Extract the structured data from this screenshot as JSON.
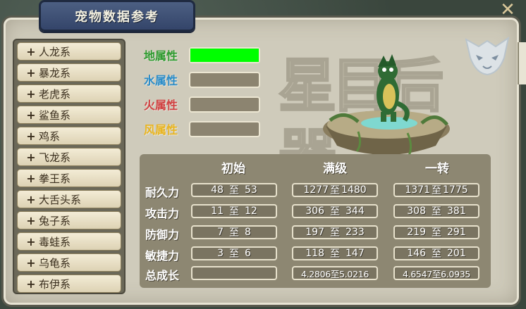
{
  "title": "宠物数据参考",
  "sidebar": {
    "items": [
      {
        "label": "人龙系"
      },
      {
        "label": "暴龙系"
      },
      {
        "label": "老虎系"
      },
      {
        "label": "鲨鱼系"
      },
      {
        "label": "鸡系"
      },
      {
        "label": "飞龙系"
      },
      {
        "label": "拳王系"
      },
      {
        "label": "大舌头系"
      },
      {
        "label": "兔子系"
      },
      {
        "label": "毒蛙系"
      },
      {
        "label": "乌龟系"
      },
      {
        "label": "布伊系"
      }
    ]
  },
  "attributes": [
    {
      "label": "地属性",
      "color": "#2e9a2e",
      "fill": 1.0,
      "fill_color": "#00ff00"
    },
    {
      "label": "水属性",
      "color": "#2a8cc8",
      "fill": 0.0
    },
    {
      "label": "火属性",
      "color": "#d04040",
      "fill": 0.0
    },
    {
      "label": "风属性",
      "color": "#e8b420",
      "fill": 0.0
    }
  ],
  "watermark": "星目后器",
  "stats": {
    "columns": [
      "初始",
      "满级",
      "一转"
    ],
    "separator": "至",
    "rows": [
      {
        "label": "耐久力",
        "values": [
          [
            "48",
            "53"
          ],
          [
            "1277",
            "1480"
          ],
          [
            "1371",
            "1775"
          ]
        ]
      },
      {
        "label": "攻击力",
        "values": [
          [
            "11",
            "12"
          ],
          [
            "306",
            "344"
          ],
          [
            "308",
            "381"
          ]
        ]
      },
      {
        "label": "防御力",
        "values": [
          [
            "7",
            "8"
          ],
          [
            "197",
            "233"
          ],
          [
            "219",
            "291"
          ]
        ]
      },
      {
        "label": "敏捷力",
        "values": [
          [
            "3",
            "6"
          ],
          [
            "118",
            "147"
          ],
          [
            "146",
            "201"
          ]
        ]
      }
    ],
    "growth": {
      "label": "总成长",
      "values": [
        "",
        "4.2806至5.0216",
        "4.6547至6.0935"
      ]
    }
  }
}
